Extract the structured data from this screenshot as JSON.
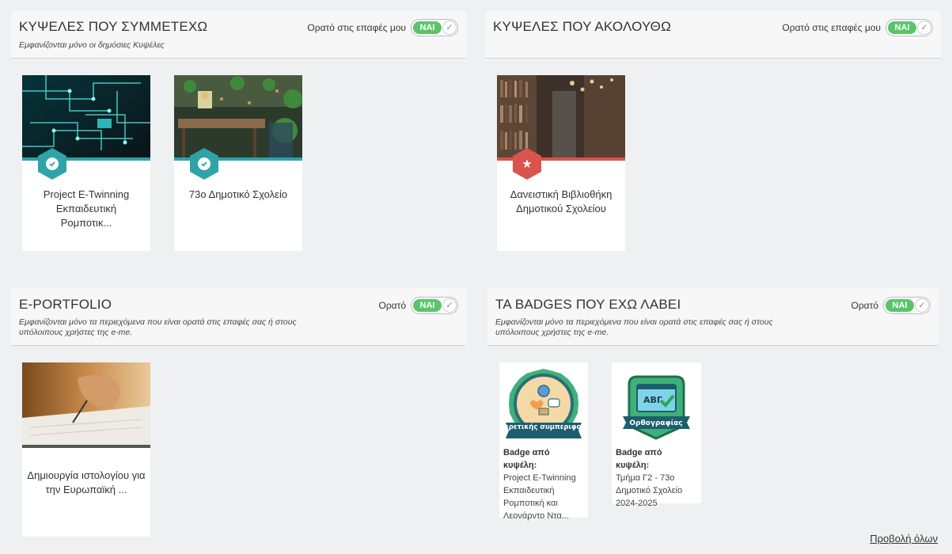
{
  "panels": {
    "participating": {
      "title": "ΚΥΨΕΛΕΣ ΠΟΥ ΣΥΜΜΕΤΕΧΩ",
      "subtitle": "Εμφανίζονται μόνο οι δημόσιες Κυψέλες",
      "visibility_label": "Ορατό στις επαφές μου",
      "toggle_label": "ΝΑΙ",
      "cards": [
        {
          "name": "Project E-Twinning Εκπαιδευτική Ρομποτικ...",
          "badge_icon": "check-icon"
        },
        {
          "name": "73ο Δημοτικό Σχολείο",
          "badge_icon": "check-icon"
        }
      ]
    },
    "following": {
      "title": "ΚΥΨΕΛΕΣ ΠΟΥ ΑΚΟΛΟΥΘΩ",
      "visibility_label": "Ορατό στις επαφές μου",
      "toggle_label": "ΝΑΙ",
      "cards": [
        {
          "name": "Δανειστική Βιβλιοθήκη Δημοτικού Σχολείου",
          "badge_icon": "star-icon"
        }
      ]
    },
    "eportfolio": {
      "title": "E-PORTFOLIO",
      "subtitle_line1": "Εμφανίζονται μόνο τα περιεχόμενα που είναι ορατά στις επαφές σας ή στους",
      "subtitle_line2": "υπόλοιπους χρήστες της e-me.",
      "visibility_label": "Ορατό",
      "toggle_label": "ΝΑΙ",
      "cards": [
        {
          "name": "Δημιουργία ιστολογίου για την Ευρωπαϊκή ..."
        }
      ]
    },
    "badges": {
      "title": "ΤΑ BADGES ΠΟΥ ΕΧΩ ΛΑΒΕΙ",
      "subtitle_line1": "Εμφανίζονται μόνο τα περιεχόμενα που είναι ορατά στις επαφές σας ή στους",
      "subtitle_line2": "υπόλοιπους χρήστες της e-me.",
      "visibility_label": "Ορατό",
      "toggle_label": "ΝΑΙ",
      "items": [
        {
          "ribbon": "Εξαιρετικής συμπεριφοράς",
          "from_label": "Badge από κυψέλη:",
          "source": "Project E-Twinning Εκπαιδευτική Ρομποτική και Λεονάρντο Ντα..."
        },
        {
          "ribbon": "Ορθογραφίας",
          "screen_text": "ΑΒΓ",
          "from_label": "Badge από κυψέλη:",
          "source": "Τμήμα Γ2 - 73ο Δημοτικό Σχολείο 2024-2025"
        }
      ]
    }
  },
  "view_all": "Προβολή όλων",
  "colors": {
    "teal": "#2fa3a8",
    "red": "#d9534f",
    "toggle_green": "#5bc46b",
    "strip_grey": "#555555"
  }
}
